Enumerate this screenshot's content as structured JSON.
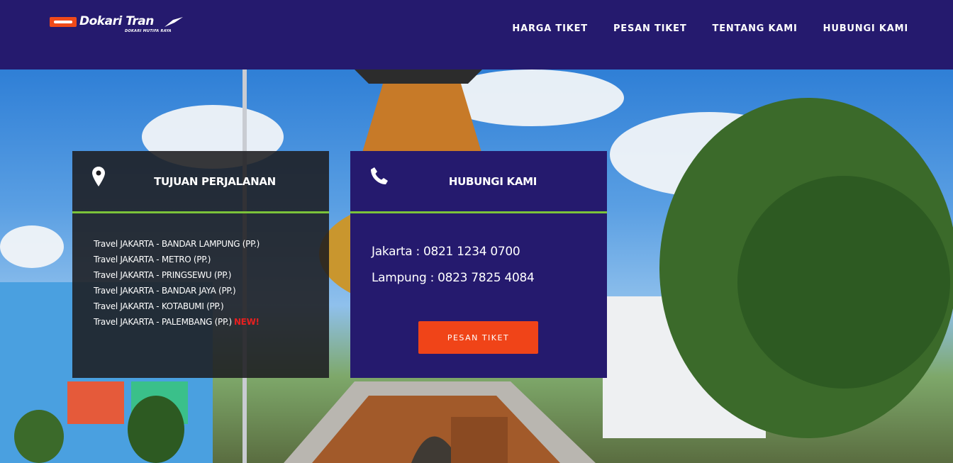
{
  "header": {
    "logo_text": "Dokari Tran",
    "logo_tagline": "DOKARI MUTIFA RAYA",
    "nav": [
      {
        "label": "HARGA TIKET"
      },
      {
        "label": "PESAN TIKET"
      },
      {
        "label": "TENTANG KAMI"
      },
      {
        "label": "HUBUNGI KAMI"
      }
    ]
  },
  "destinations": {
    "icon": "map-marker-icon",
    "title": "TUJUAN PERJALANAN",
    "routes": [
      {
        "label": "Travel JAKARTA - BANDAR LAMPUNG (PP.)",
        "badge": ""
      },
      {
        "label": "Travel JAKARTA - METRO (PP.)",
        "badge": ""
      },
      {
        "label": "Travel JAKARTA - PRINGSEWU (PP.)",
        "badge": ""
      },
      {
        "label": "Travel JAKARTA - BANDAR JAYA (PP.)",
        "badge": ""
      },
      {
        "label": "Travel JAKARTA - KOTABUMI (PP.)",
        "badge": ""
      },
      {
        "label": "Travel JAKARTA - PALEMBANG (PP.)",
        "badge": "NEW!"
      }
    ]
  },
  "contact": {
    "icon": "phone-icon",
    "title": "HUBUNGI KAMI",
    "phones": [
      {
        "label": "Jakarta : 0821 1234 0700"
      },
      {
        "label": "Lampung : 0823 7825 4084"
      }
    ],
    "cta_label": "PESAN TIKET"
  },
  "colors": {
    "header_bg": "#251a6e",
    "accent_green": "#7bc33a",
    "cta_orange": "#f04418",
    "new_badge_red": "#e62020"
  }
}
